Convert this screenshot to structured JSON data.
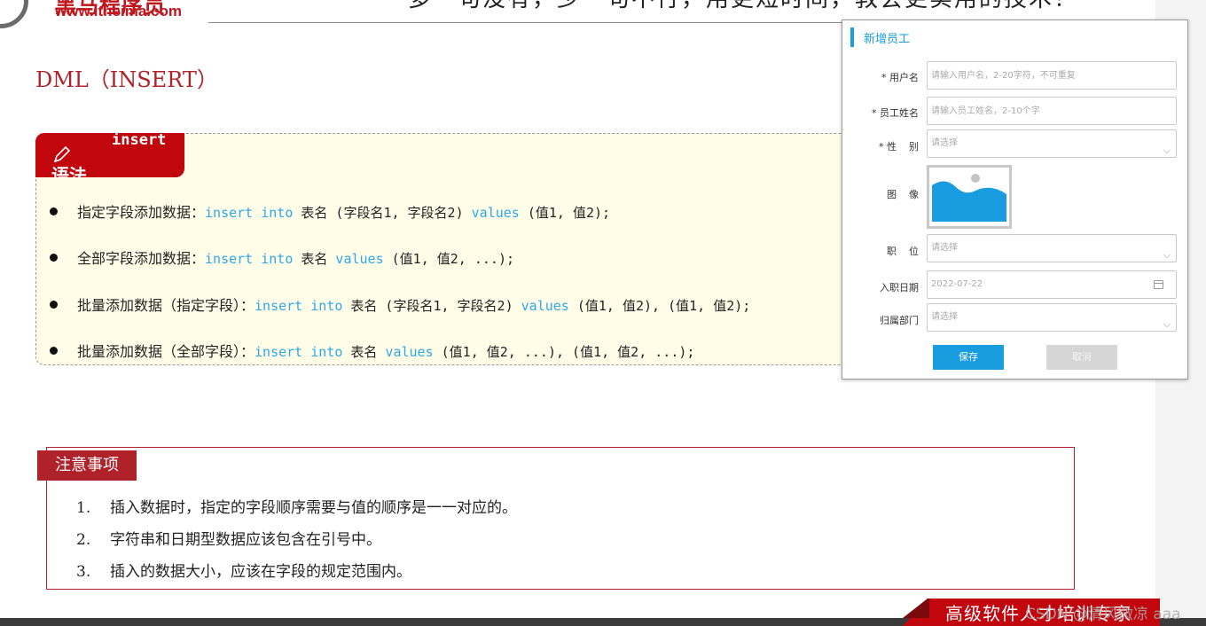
{
  "header": {
    "logo_cn": "黑马程序员",
    "logo_url": "www.itheima.com",
    "slogan": "多一句没有，少一句不行，用更短时间，教会更实用的技术！"
  },
  "page_title": "DML（INSERT）",
  "syntax": {
    "tab_keyword": "insert",
    "tab_label": "语法",
    "items": [
      {
        "label": "指定字段添加数据：",
        "parts": [
          [
            "k",
            "insert into"
          ],
          [
            "t",
            " 表名 (字段名1, 字段名2) "
          ],
          [
            "k",
            "values"
          ],
          [
            "t",
            " (值1, 值2);"
          ]
        ]
      },
      {
        "label": "全部字段添加数据：",
        "parts": [
          [
            "k",
            "insert into"
          ],
          [
            "t",
            " 表名 "
          ],
          [
            "k",
            "values"
          ],
          [
            "t",
            " (值1, 值2, ...);"
          ]
        ]
      },
      {
        "label": "批量添加数据（指定字段）：",
        "parts": [
          [
            "k",
            "insert into"
          ],
          [
            "t",
            " 表名 (字段名1, 字段名2) "
          ],
          [
            "k",
            "values"
          ],
          [
            "t",
            " (值1, 值2), (值1, 值2);"
          ]
        ]
      },
      {
        "label": "批量添加数据（全部字段）：",
        "parts": [
          [
            "k",
            "insert into"
          ],
          [
            "t",
            " 表名 "
          ],
          [
            "k",
            "values"
          ],
          [
            "t",
            " (值1, 值2, ...), (值1, 值2, ...);"
          ]
        ]
      }
    ]
  },
  "notes": {
    "title": "注意事项",
    "items": [
      {
        "num": "1.",
        "text": "插入数据时，指定的字段顺序需要与值的顺序是一一对应的。"
      },
      {
        "num": "2.",
        "text": "字符串和日期型数据应该包含在引号中。"
      },
      {
        "num": "3.",
        "text": "插入的数据大小，应该在字段的规定范围内。"
      }
    ]
  },
  "footer": {
    "text": "高级软件人才培训专家",
    "watermark": "CSDN @清风微凉 aaa"
  },
  "dialog": {
    "title": "新增员工",
    "username": {
      "label": "* 用户名",
      "placeholder": "请输入用户名，2-20字符，不可重复"
    },
    "name": {
      "label": "* 员工姓名",
      "placeholder": "请输入员工姓名，2-10个字"
    },
    "gender": {
      "label": "* 性    别",
      "value": "请选择"
    },
    "image": {
      "label": "图    像"
    },
    "position": {
      "label": "职    位",
      "value": "请选择"
    },
    "entry_date": {
      "label": "入职日期",
      "value": "2022-07-22"
    },
    "department": {
      "label": "归属部门",
      "value": "请选择"
    },
    "save_label": "保存",
    "cancel_label": "取消",
    "accent_color": "#1a9de0"
  }
}
